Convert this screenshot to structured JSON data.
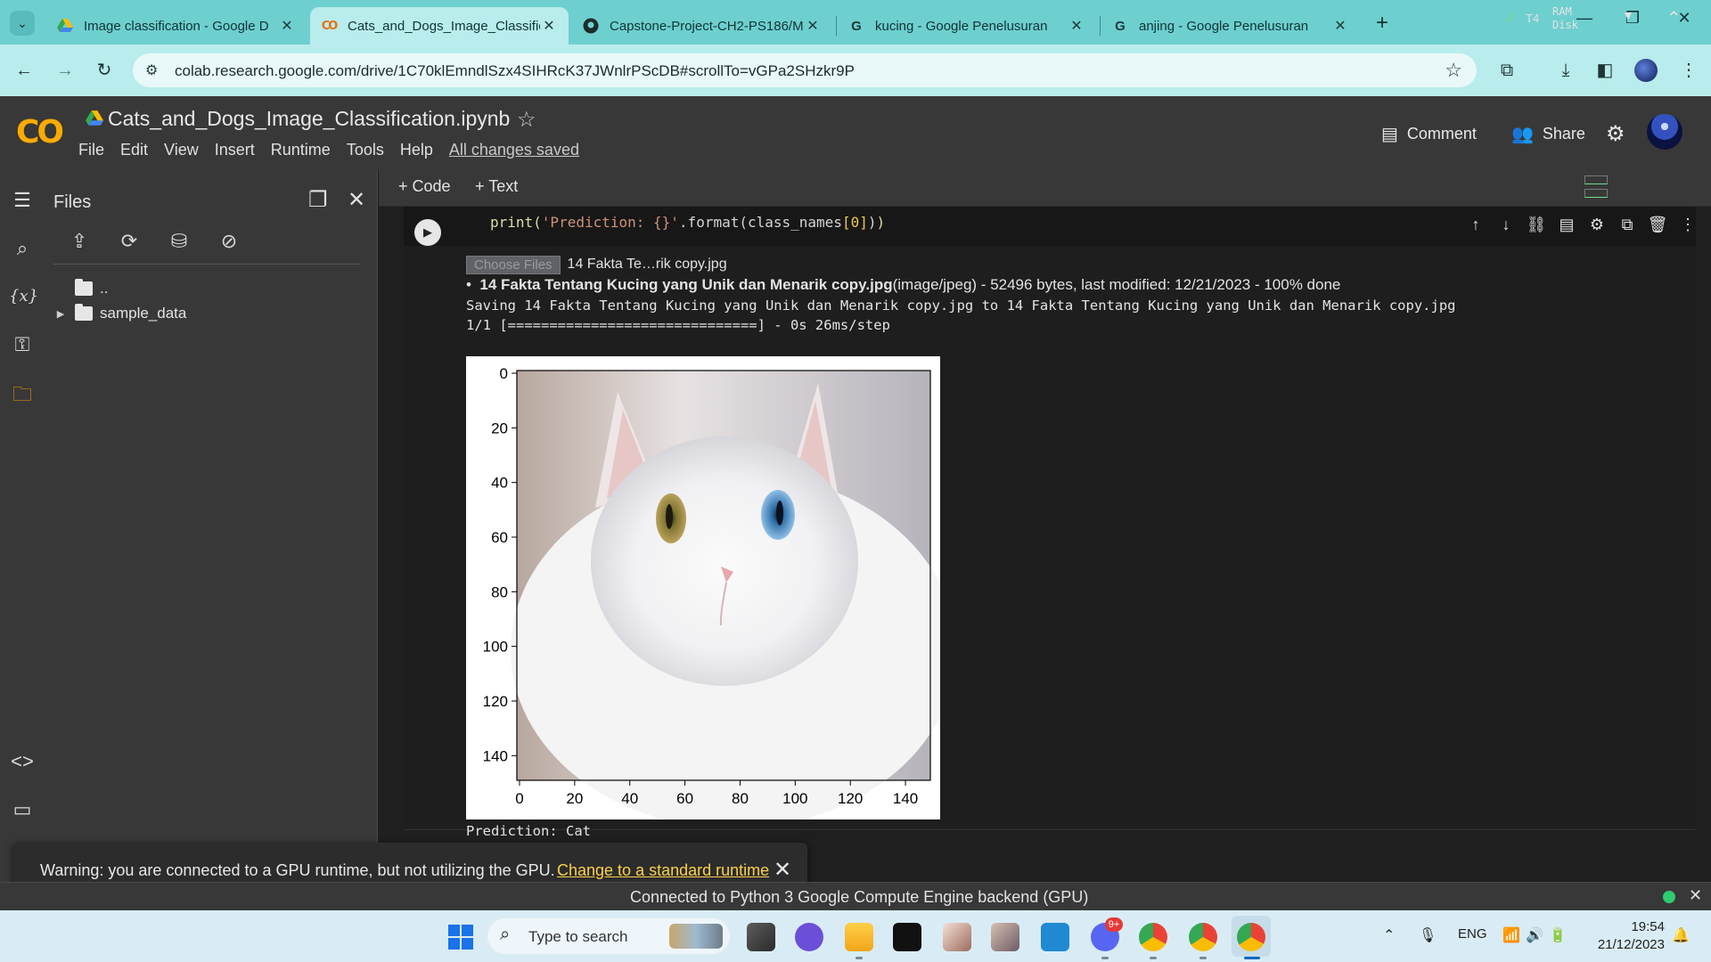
{
  "browser": {
    "tabs": [
      {
        "title": "Image classification - Google D",
        "favicon": "drive-icon",
        "active": false
      },
      {
        "title": "Cats_and_Dogs_Image_Classific",
        "favicon": "colab-icon",
        "active": true
      },
      {
        "title": "Capstone-Project-CH2-PS186/M",
        "favicon": "github-icon",
        "active": false
      },
      {
        "title": "kucing - Google Penelusuran",
        "favicon": "google-icon",
        "active": false
      },
      {
        "title": "anjing - Google Penelusuran",
        "favicon": "google-icon",
        "active": false
      }
    ],
    "url": "colab.research.google.com/drive/1C70klEmndlSzx4SIHRcK37JWnlrPScDB#scrollTo=vGPa2SHzkr9P"
  },
  "colab": {
    "notebook_title": "Cats_and_Dogs_Image_Classification.ipynb",
    "menu": [
      "File",
      "Edit",
      "View",
      "Insert",
      "Runtime",
      "Tools",
      "Help"
    ],
    "saved_status": "All changes saved",
    "comment_label": "Comment",
    "share_label": "Share"
  },
  "files_panel": {
    "title": "Files",
    "tree": [
      {
        "label": ".."
      },
      {
        "label": "sample_data"
      }
    ]
  },
  "notebook_toolbar": {
    "add_code": "Code",
    "add_text": "Text",
    "runtime": "T4",
    "ram_label": "RAM",
    "disk_label": "Disk"
  },
  "cell": {
    "code_prefix": "print(",
    "code_string": "'Prediction: {}'",
    "code_mid": ".format(class_names",
    "code_index": "[0]",
    "code_end": ")",
    "choose_button": "Choose Files",
    "chosen_file": "14 Fakta Te…rik copy.jpg",
    "upload_bullet": "•",
    "upload_filename": "14 Fakta Tentang Kucing yang Unik dan Menarik copy.jpg",
    "upload_meta": "(image/jpeg) - 52496 bytes, last modified: 12/21/2023 - 100% done",
    "saving_line": "Saving 14 Fakta Tentang Kucing yang Unik dan Menarik copy.jpg to 14 Fakta Tentang Kucing yang Unik dan Menarik copy.jpg",
    "progress_line": "1/1 [==============================] - 0s 26ms/step",
    "prediction_line": "Prediction: Cat"
  },
  "plot": {
    "x_ticks": [
      "0",
      "20",
      "40",
      "60",
      "80",
      "100",
      "120",
      "140"
    ],
    "y_ticks": [
      "0",
      "20",
      "40",
      "60",
      "80",
      "100",
      "120",
      "140"
    ],
    "axis_range": [
      0,
      150
    ],
    "image_subject": "white cat with heterochromatic eyes (amber left, blue right)"
  },
  "snackbar": {
    "message": "Warning: you are connected to a GPU runtime, but not utilizing the GPU.",
    "link": "Change to a standard runtime"
  },
  "status": {
    "text": "Connected to Python 3 Google Compute Engine backend (GPU)"
  },
  "taskbar": {
    "search_placeholder": "Type to search",
    "discord_badge": "9+",
    "language": "ENG",
    "time": "19:54",
    "date": "21/12/2023"
  }
}
